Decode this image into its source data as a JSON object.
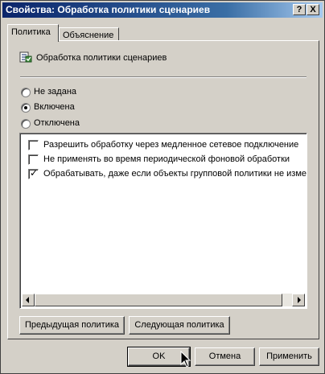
{
  "window": {
    "title": "Свойства: Обработка политики сценариев",
    "help_label": "?",
    "close_label": "X"
  },
  "tabs": [
    {
      "label": "Политика",
      "active": true
    },
    {
      "label": "Объяснение",
      "active": false
    }
  ],
  "policy": {
    "name": "Обработка политики сценариев",
    "icon": "policy-setting-icon"
  },
  "radios": [
    {
      "label": "Не задана",
      "checked": false
    },
    {
      "label": "Включена",
      "checked": true
    },
    {
      "label": "Отключена",
      "checked": false
    }
  ],
  "options": [
    {
      "label": "Разрешить обработку через медленное сетевое подключение",
      "checked": false
    },
    {
      "label": "Не применять во время периодической фоновой обработки",
      "checked": false
    },
    {
      "label": "Обрабатывать, даже если объекты групповой политики не изменились",
      "checked": true
    }
  ],
  "nav_buttons": {
    "previous": "Предыдущая политика",
    "next": "Следующая политика"
  },
  "dialog_buttons": {
    "ok": "OK",
    "cancel": "Отмена",
    "apply": "Применить"
  }
}
